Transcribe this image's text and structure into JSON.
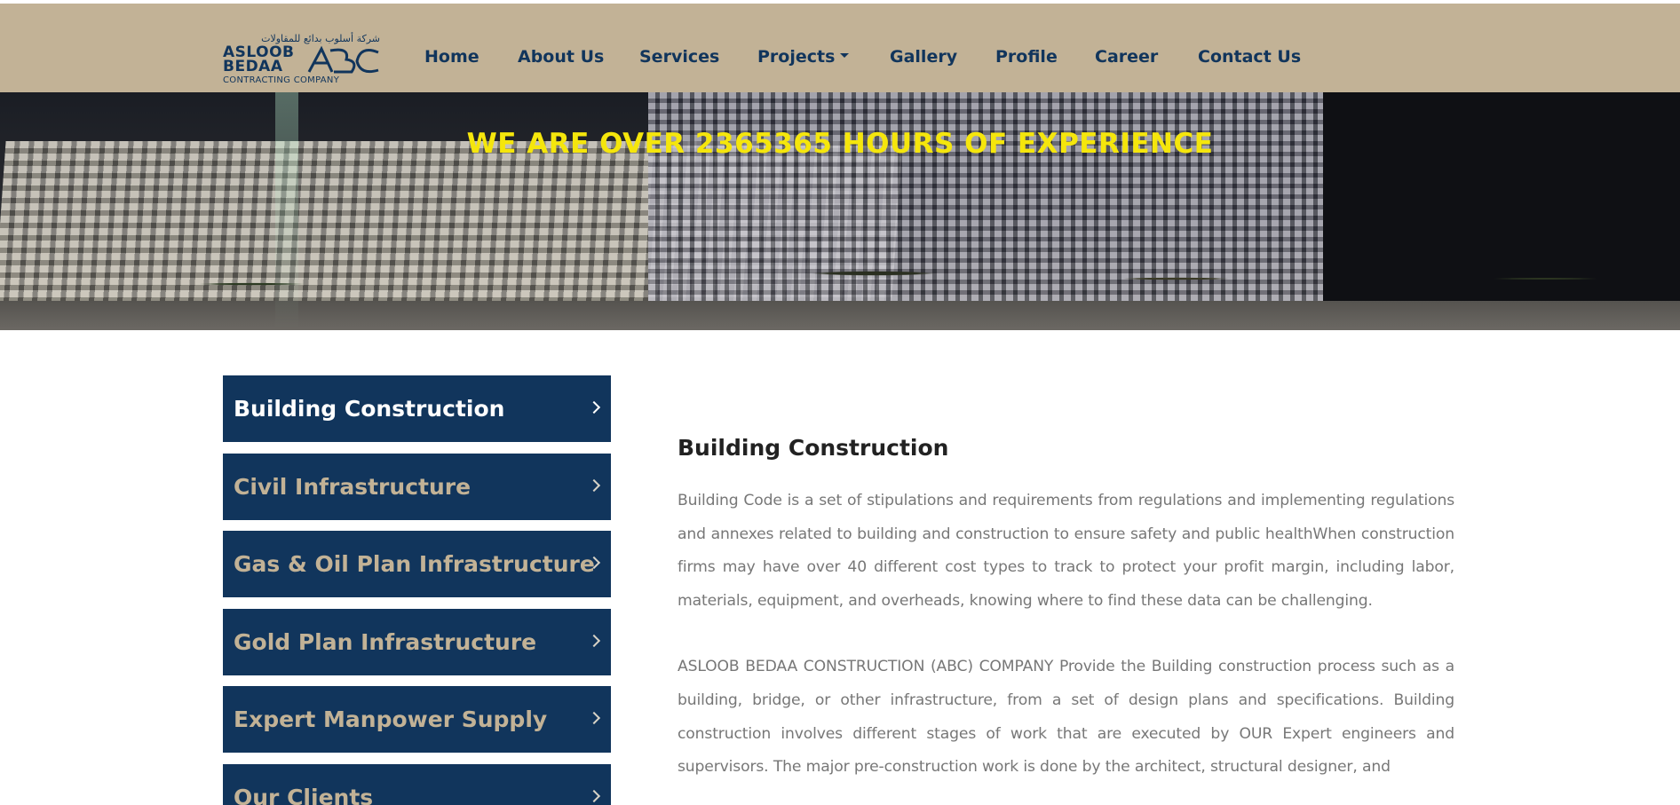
{
  "header": {
    "logo": {
      "arabic": "شركة أسلوب بدائع للمقاولات",
      "line1": "ASLOOB",
      "line2": "BEDAA",
      "tagline": "CONTRACTING COMPANY",
      "mark": "ABC"
    },
    "nav": [
      {
        "label": "Home"
      },
      {
        "label": "About Us"
      },
      {
        "label": "Services"
      },
      {
        "label": "Projects",
        "has_dropdown": true
      },
      {
        "label": "Gallery"
      },
      {
        "label": "Profile"
      },
      {
        "label": "Career"
      },
      {
        "label": "Contact Us"
      }
    ],
    "colors": {
      "bar": "#c2b296",
      "link": "#11355c"
    }
  },
  "hero": {
    "headline": "WE ARE OVER 2365365 HOURS OF EXPERIENCE",
    "headline_color": "#f5e60c"
  },
  "sidebar": {
    "items": [
      {
        "label": "Building Construction",
        "active": true
      },
      {
        "label": "Civil Infrastructure",
        "active": false
      },
      {
        "label": "Gas & Oil Plan Infrastructure",
        "active": false
      },
      {
        "label": "Gold Plan Infrastructure",
        "active": false
      },
      {
        "label": "Expert Manpower Supply",
        "active": false
      },
      {
        "label": "Our Clients",
        "active": false
      }
    ],
    "colors": {
      "background": "#11355c",
      "active_text": "#ffffff",
      "text": "#c2b296"
    }
  },
  "main": {
    "title": "Building Construction",
    "paragraphs": [
      "Building Code is a set of stipulations and requirements from regulations and implementing regulations and annexes related to building and construction to ensure safety and public healthWhen construction firms may have over 40 different cost types to track to protect your profit margin, including labor, materials, equipment, and overheads, knowing where to find these data can be challenging.",
      "ASLOOB BEDAA CONSTRUCTION (ABC) COMPANY Provide the Building construction process such as a building, bridge, or other infrastructure, from a set of design plans and specifications. Building construction involves different stages of work that are executed by OUR Expert engineers and supervisors. The major pre-construction work is done by the architect, structural designer, and"
    ]
  }
}
